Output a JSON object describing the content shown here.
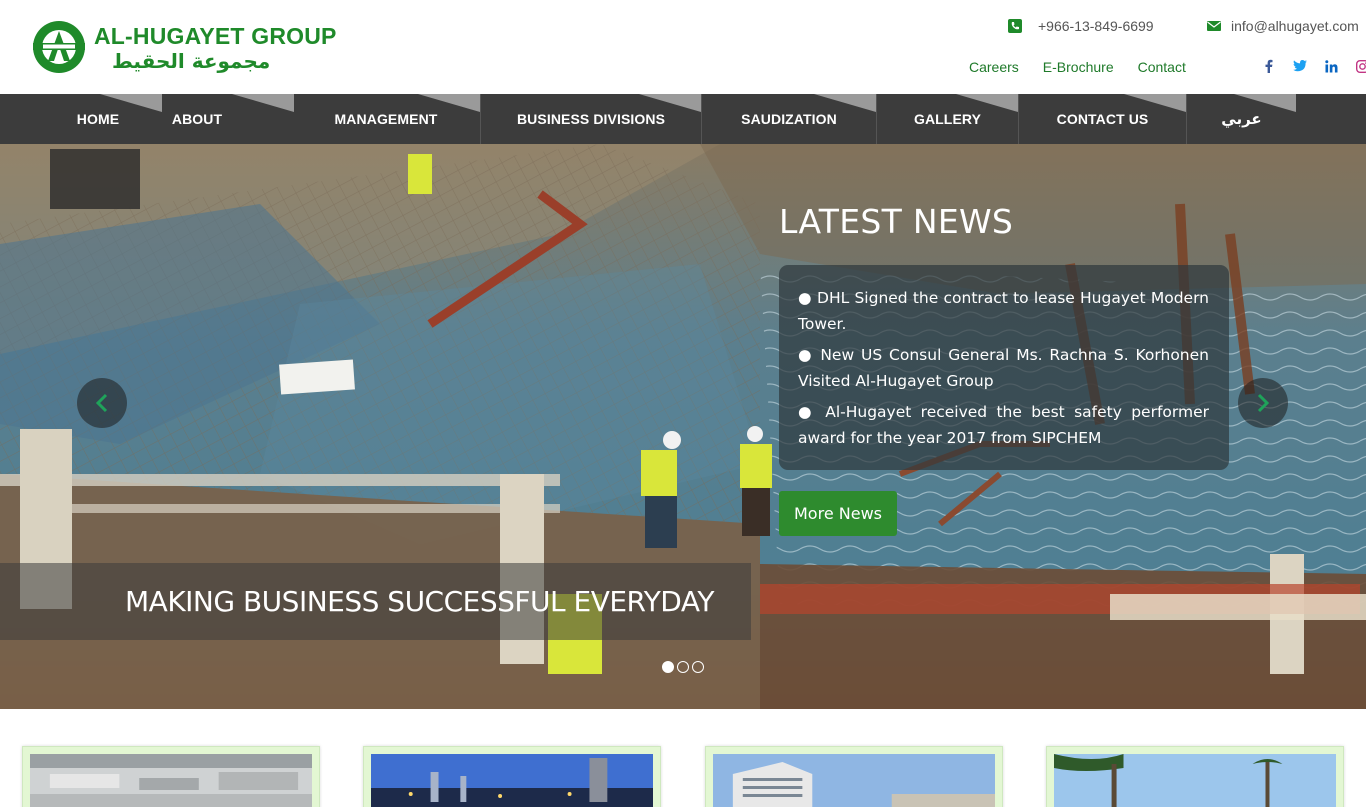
{
  "brand": {
    "name_en": "AL-HUGAYET GROUP",
    "name_ar": "مجموعة الحقيط",
    "colors": {
      "green": "#1f8a2a",
      "nav_bg": "#3c3c3c",
      "button_green": "#2e8b2e"
    }
  },
  "contact": {
    "phone": "+966-13-849-6699",
    "email": "info@alhugayet.com",
    "phone_icon": "phone-icon",
    "email_icon": "envelope-icon"
  },
  "top_links": [
    "Careers",
    "E-Brochure",
    "Contact"
  ],
  "social": [
    "facebook-icon",
    "twitter-icon",
    "linkedin-icon",
    "instagram-icon"
  ],
  "nav": [
    "HOME",
    "ABOUT",
    "MANAGEMENT",
    "BUSINESS DIVISIONS",
    "SAUDIZATION",
    "GALLERY",
    "CONTACT US",
    "عربي"
  ],
  "hero": {
    "news_title": "LATEST NEWS",
    "news_items": [
      "● DHL Signed the contract to lease Hugayet Modern Tower.",
      "● New US Consul General Ms. Rachna S. Korhonen Visited Al-Hugayet Group",
      "● Al-Hugayet received the best safety performer award for the year 2017 from SIPCHEM"
    ],
    "more_news_label": "More News",
    "tagline": "MAKING BUSINESS SUCCESSFUL EVERYDAY",
    "slide_count": 3,
    "active_slide": 1
  }
}
